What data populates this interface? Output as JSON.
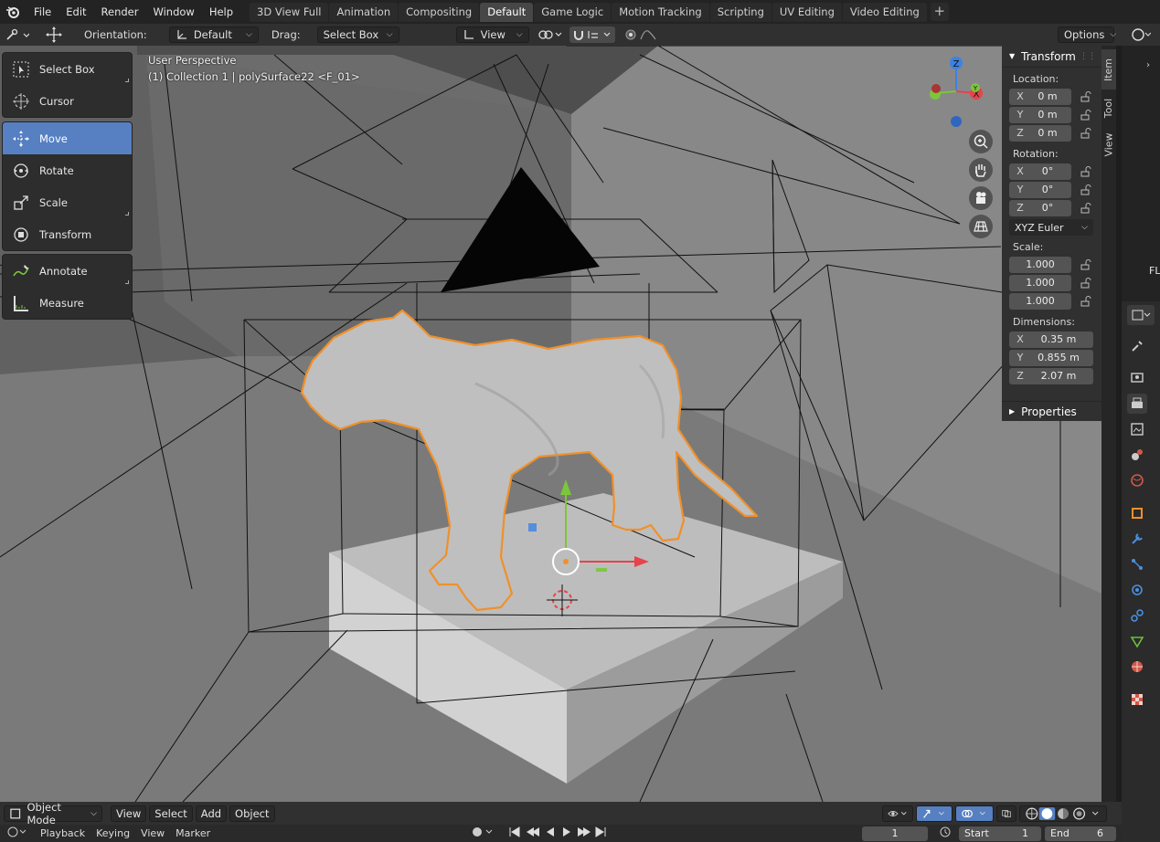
{
  "menubar": {
    "items": [
      "File",
      "Edit",
      "Render",
      "Window",
      "Help"
    ],
    "workspaces": [
      "3D View Full",
      "Animation",
      "Compositing",
      "Default",
      "Game Logic",
      "Motion Tracking",
      "Scripting",
      "UV Editing",
      "Video Editing"
    ],
    "active_workspace": "Default",
    "add_label": "+"
  },
  "header": {
    "orientation_label": "Orientation:",
    "orientation_value": "Default",
    "drag_label": "Drag:",
    "drag_value": "Select Box",
    "view_label": "View",
    "options_label": "Options"
  },
  "viewport": {
    "perspective": "User Perspective",
    "collection_info": "(1) Collection 1 | polySurface22 <F_01>"
  },
  "tools": {
    "group1": [
      "Select Box",
      "Cursor"
    ],
    "group2": [
      "Move",
      "Rotate",
      "Scale",
      "Transform"
    ],
    "group3": [
      "Annotate",
      "Measure"
    ],
    "active_tool": "Move"
  },
  "gizmo": {
    "x": "X",
    "y": "Y",
    "z": "Z",
    "x_color": "#e8424b",
    "y_color": "#7bc63a",
    "z_color": "#3b82e6"
  },
  "npanel": {
    "title": "Transform",
    "location_label": "Location:",
    "location": [
      {
        "axis": "X",
        "value": "0 m"
      },
      {
        "axis": "Y",
        "value": "0 m"
      },
      {
        "axis": "Z",
        "value": "0 m"
      }
    ],
    "rotation_label": "Rotation:",
    "rotation": [
      {
        "axis": "X",
        "value": "0°"
      },
      {
        "axis": "Y",
        "value": "0°"
      },
      {
        "axis": "Z",
        "value": "0°"
      }
    ],
    "rotation_mode": "XYZ Euler",
    "scale_label": "Scale:",
    "scale": [
      "1.000",
      "1.000",
      "1.000"
    ],
    "dimensions_label": "Dimensions:",
    "dimensions": [
      {
        "axis": "X",
        "value": "0.35 m"
      },
      {
        "axis": "Y",
        "value": "0.855 m"
      },
      {
        "axis": "Z",
        "value": "2.07 m"
      }
    ],
    "properties_label": "Properties",
    "tabs": [
      "Item",
      "Tool",
      "View"
    ]
  },
  "footer": {
    "mode": "Object Mode",
    "menus": [
      "View",
      "Select",
      "Add",
      "Object"
    ]
  },
  "timeline": {
    "items": [
      "Playback",
      "Keying",
      "View",
      "Marker"
    ],
    "current_frame": "1",
    "start_label": "Start",
    "start_value": "1",
    "end_label": "End",
    "end_value": "6"
  },
  "right_strip_label": "FL",
  "colors": {
    "accent": "#5680c2",
    "selection_outline": "#f0902a",
    "viewport_bg": "#6c6c6c"
  }
}
